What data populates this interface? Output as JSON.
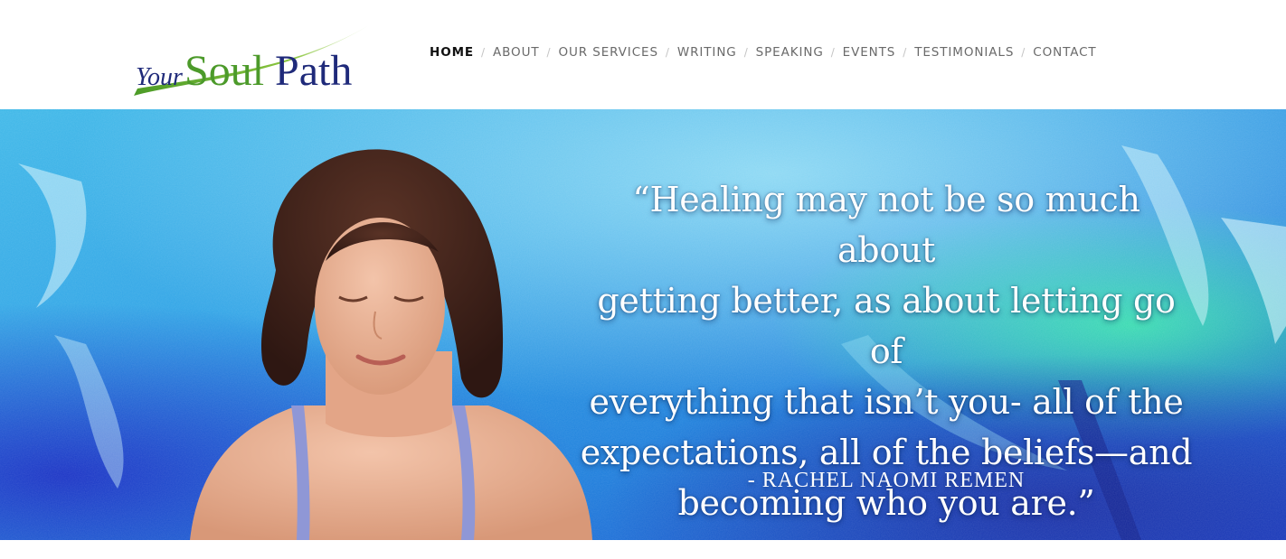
{
  "logo": {
    "your": "Your",
    "soul": "Soul",
    "path": "Path"
  },
  "nav": {
    "items": [
      {
        "label": "HOME",
        "active": true
      },
      {
        "label": "ABOUT",
        "active": false
      },
      {
        "label": "OUR SERVICES",
        "active": false
      },
      {
        "label": "WRITING",
        "active": false
      },
      {
        "label": "SPEAKING",
        "active": false
      },
      {
        "label": "EVENTS",
        "active": false
      },
      {
        "label": "TESTIMONIALS",
        "active": false
      },
      {
        "label": "CONTACT",
        "active": false
      }
    ],
    "separator": "/"
  },
  "hero": {
    "quote_lines": [
      "“Healing may not be so much about",
      "getting better, as about letting go of",
      "everything that isn’t you- all of the",
      "expectations, all of the beliefs—and",
      "becoming who you are.”"
    ],
    "attribution": "- RACHEL NAOMI REMEN"
  },
  "colors": {
    "nav_active": "#111111",
    "nav_inactive": "#6a6a6a",
    "logo_green": "#5aa832",
    "logo_navy": "#1f2a7a",
    "hero_light": "#6fd3f0",
    "hero_deep": "#1c34c9"
  }
}
